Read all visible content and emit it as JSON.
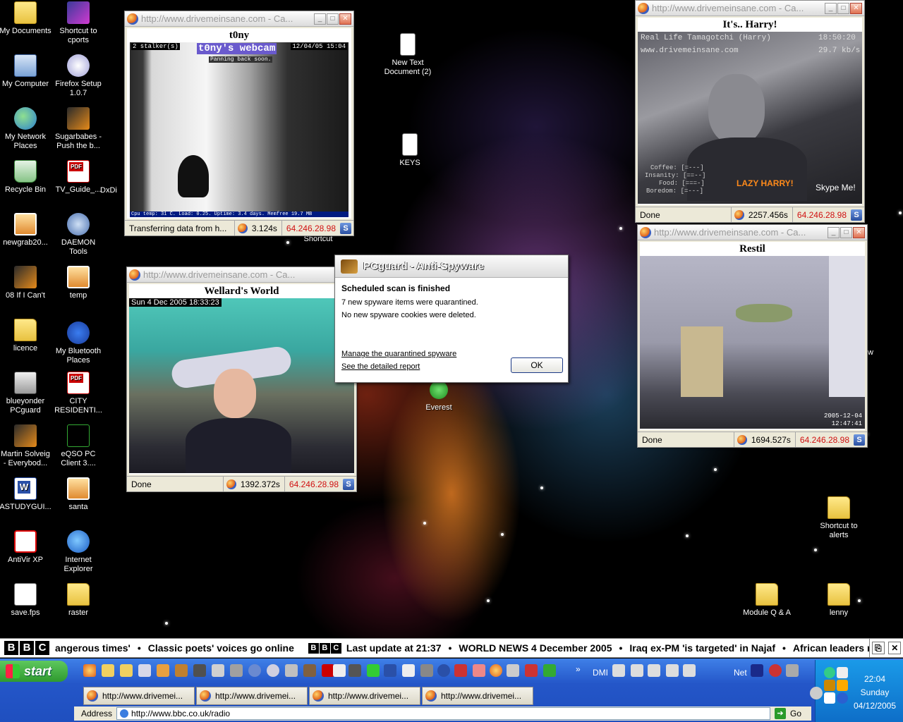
{
  "desktop": {
    "icons_left": [
      {
        "label": "My Documents",
        "icon": "documents-folder-icon"
      },
      {
        "label": "My Computer",
        "icon": "computer-icon"
      },
      {
        "label": "My Network Places",
        "icon": "network-icon"
      },
      {
        "label": "Recycle Bin",
        "icon": "recycle-bin-icon"
      },
      {
        "label": "newgrab20...",
        "icon": "image-file-icon"
      },
      {
        "label": "08 If I Can't",
        "icon": "winamp-icon"
      },
      {
        "label": "licence",
        "icon": "folder-icon"
      },
      {
        "label": "blueyonder PCguard",
        "icon": "lock-icon"
      },
      {
        "label": "Martin Solveig - Everybod...",
        "icon": "winamp-icon"
      },
      {
        "label": "ASTUDYGUI...",
        "icon": "word-icon"
      },
      {
        "label": "AntiVir XP",
        "icon": "antivir-icon"
      },
      {
        "label": "save.fps",
        "icon": "file-icon"
      }
    ],
    "icons_col2": [
      {
        "label": "Shortcut to cports",
        "icon": "cports-icon"
      },
      {
        "label": "Firefox Setup 1.0.7",
        "icon": "installer-icon"
      },
      {
        "label": "Sugarbabes - Push the b...",
        "icon": "winamp-icon"
      },
      {
        "label": "TV_Guide_...",
        "icon": "pdf-icon"
      },
      {
        "label": "DAEMON Tools",
        "icon": "daemon-tools-icon"
      },
      {
        "label": "temp",
        "icon": "image-file-icon"
      },
      {
        "label": "My Bluetooth Places",
        "icon": "bluetooth-icon"
      },
      {
        "label": "CITY RESIDENTI...",
        "icon": "pdf-icon"
      },
      {
        "label": "eQSO PC Client 3....",
        "icon": "eqso-icon"
      },
      {
        "label": "santa",
        "icon": "image-file-icon"
      },
      {
        "label": "Internet Explorer",
        "icon": "internet-explorer-icon"
      },
      {
        "label": "raster",
        "icon": "folder-icon"
      }
    ],
    "partial_label": "DxDi",
    "other_icons": {
      "new_text_doc": "New Text Document (2)",
      "keys": "KEYS",
      "shortcut": "Shortcut",
      "everest": "Everest",
      "shortcut_alerts": "Shortcut to alerts",
      "module_qa": "Module Q & A",
      "lenny": "lenny",
      "partial_w": "w"
    }
  },
  "windows": [
    {
      "title": "http://www.drivemeinsane.com - Ca...",
      "page_title": "t0ny",
      "cam_overlay_left": "2 stalker(s)",
      "cam_overlay_title": "t0ny's webcam",
      "cam_overlay_sub": "Panning back soon.",
      "cam_overlay_date": "12/04/05 15:04",
      "cam_overlay_bottom": "Cpu temp: 31 C. Load: 0.25. Uptime: 3.4 days. Memfree 19.7 MB",
      "status": "Transferring data from h...",
      "time": "3.124s",
      "ip": "64.246.28.98"
    },
    {
      "title": "http://www.drivemeinsane.com - Ca...",
      "page_title": "Wellard's World",
      "cam_overlay_date": "Sun 4 Dec 2005 18:33:23",
      "status": "Done",
      "time": "1392.372s",
      "ip": "64.246.28.98"
    },
    {
      "title": "http://www.drivemeinsane.com - Ca...",
      "page_title": "It's.. Harry!",
      "cam_overlay_l1": "Real Life Tamagotchi (Harry)",
      "cam_overlay_l2": "www.drivemeinsane.com",
      "cam_overlay_time": "18:50:20",
      "cam_overlay_rate": "29.7 kb/s",
      "stats": [
        "Coffee: [=---]",
        "Insanity: [==--]",
        "Food: [===-]",
        "Boredom: [=---]"
      ],
      "lazy": "LAZY HARRY!",
      "skype": "Skype Me!",
      "status": "Done",
      "time": "2257.456s",
      "ip": "64.246.28.98"
    },
    {
      "title": "http://www.drivemeinsane.com - Ca...",
      "page_title": "Restil",
      "cam_overlay_date": "2005-12-04",
      "cam_overlay_time": "12:47:41",
      "status": "Done",
      "time": "1694.527s",
      "ip": "64.246.28.98"
    }
  ],
  "dialog": {
    "title": "PCguard - Anti-Spyware",
    "heading": "Scheduled scan is finished",
    "line1": "7 new spyware items were quarantined.",
    "line2": "No new spyware cookies were deleted.",
    "link1": "Manage the quarantined spyware",
    "link2": "See the detailed report",
    "ok": "OK"
  },
  "ticker": {
    "items": [
      "angerous times'",
      "Classic poets' voices go online"
    ],
    "update": "Last update at 21:37",
    "news": [
      "WORLD NEWS  4 December 2005",
      "Iraq ex-PM 'is targeted' in Najaf",
      "African leaders name"
    ]
  },
  "taskbar": {
    "start": "start",
    "dmi": "DMI",
    "net": "Net",
    "tasks": [
      "http://www.drivemei...",
      "http://www.drivemei...",
      "http://www.drivemei...",
      "http://www.drivemei..."
    ],
    "address_label": "Address",
    "address_value": "http://www.bbc.co.uk/radio",
    "go": "Go",
    "clock_time": "22:04",
    "clock_day": "Sunday",
    "clock_date": "04/12/2005"
  }
}
